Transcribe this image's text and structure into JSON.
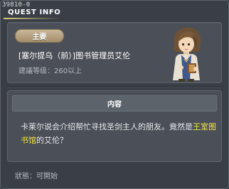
{
  "window": {
    "id_text": "39810-0",
    "title": "QUEST INFO"
  },
  "quest": {
    "badge": "主要",
    "name": "[塞尔提乌（前）]图书管理员艾伦",
    "level": "建議等级：260以上"
  },
  "content": {
    "header": "内容",
    "text_part1": "卡莱尔说会介绍帮忙寻找圣剑主人的朋友。竟然是",
    "text_highlight": "王室图书馆",
    "text_part2": "的艾伦？"
  },
  "status": {
    "text": "狀態：可開始"
  },
  "colors": {
    "window_bg": "#3a3f47",
    "panel_bg": "#4b5058",
    "badge_bg": "#b7a27f",
    "highlight": "#f0e53c",
    "title_underline": "#d8cc7a"
  },
  "icons": {
    "npc": "npc-portrait-librarian"
  }
}
